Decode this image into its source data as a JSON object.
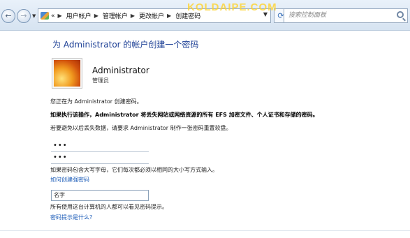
{
  "address_bar": {
    "breadcrumbs": [
      "用户帐户",
      "管理帐户",
      "更改帐户",
      "创建密码"
    ],
    "overflow_marker": "«",
    "search_placeholder": "搜索控制面板",
    "watermark": "KOLDAIPE.COM"
  },
  "page": {
    "title": "为 Administrator 的帐户创建一个密码",
    "account": {
      "name": "Administrator",
      "role": "管理员"
    },
    "info_line": "您正在为 Administrator 创建密码。",
    "warning_line": "如果执行该操作，Administrator 将丢失网站或网络资源的所有 EFS 加密文件、个人证书和存储的密码。",
    "backup_line": "若要避免以后丢失数据，请要求 Administrator 制作一张密码重置软盘。",
    "new_password_value": "•••",
    "confirm_password_value": "•••",
    "case_note": "如果密码包含大写字母，它们每次都必须以相同的大小写方式输入。",
    "strong_password_link": "如何创建强密码",
    "hint_value": "名字",
    "hint_note": "所有使用这台计算机的人都可以看见密码提示。",
    "hint_link": "密码提示是什么?"
  }
}
